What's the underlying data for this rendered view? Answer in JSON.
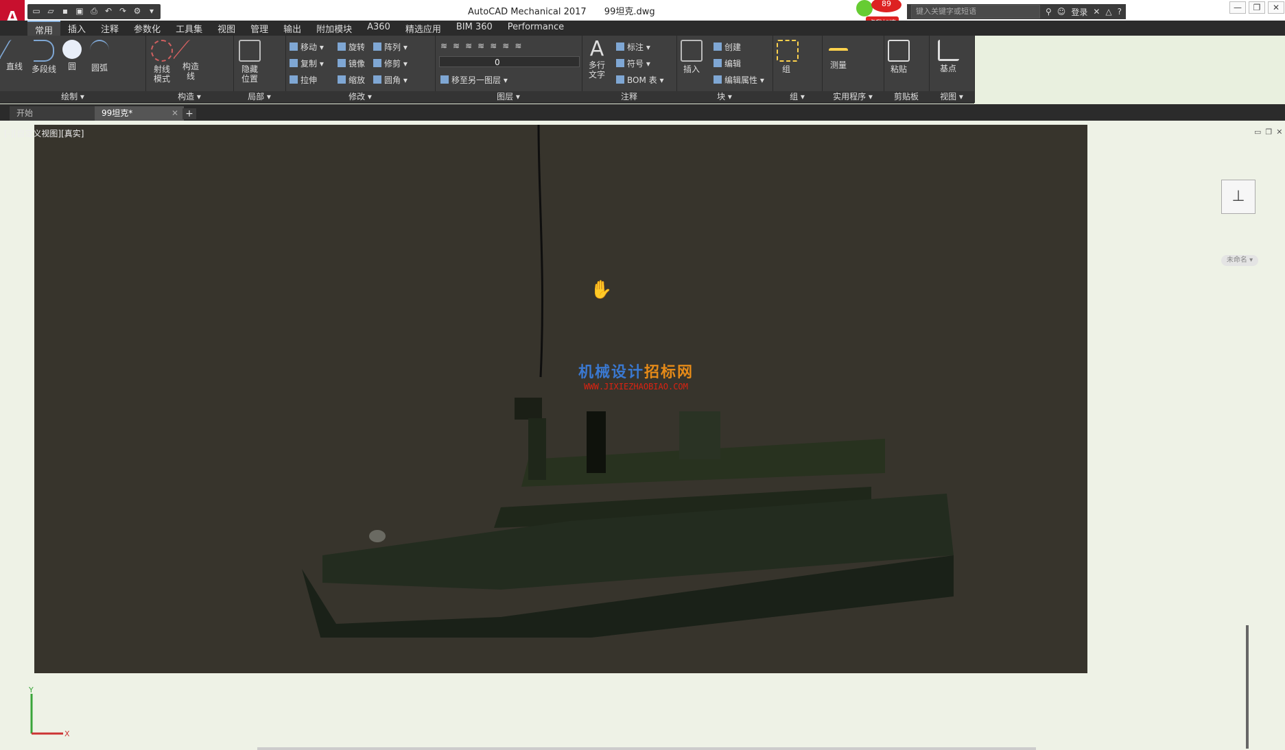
{
  "titlebar": {
    "app_title": "AutoCAD Mechanical 2017",
    "file_name": "99坦克.dwg",
    "logo_text": "A",
    "badge_count": "89",
    "badge_label": "点我加速",
    "search_placeholder": "键入关键字或短语",
    "login_label": "登录"
  },
  "ribbon_tabs": [
    "常用",
    "插入",
    "注释",
    "参数化",
    "工具集",
    "视图",
    "管理",
    "输出",
    "附加模块",
    "A360",
    "精选应用",
    "BIM 360",
    "Performance"
  ],
  "panels": {
    "draw": {
      "title": "绘制",
      "line": "直线",
      "polyline": "多段线",
      "circle": "圆",
      "arc": "圆弧"
    },
    "construct": {
      "title": "构造",
      "ray_mode": "射线\n模式",
      "construct_line": "构造\n线"
    },
    "local": {
      "title": "局部",
      "hide_pos": "隐藏\n位置"
    },
    "modify": {
      "title": "修改",
      "move": "移动",
      "rotate": "旋转",
      "array": "阵列",
      "copy": "复制",
      "mirror": "镜像",
      "trim": "修剪",
      "stretch": "拉伸",
      "scale": "缩放",
      "fillet": "圆角"
    },
    "layer": {
      "title": "图层",
      "current_layer": "0",
      "move_to_layer": "移至另一图层"
    },
    "annotation": {
      "title": "注释",
      "mtext": "多行\n文字",
      "dimension": "标注",
      "symbol": "符号",
      "bom": "BOM 表"
    },
    "block": {
      "title": "块",
      "insert": "插入",
      "create": "创建",
      "edit": "编辑",
      "edit_attr": "编辑属性"
    },
    "group": {
      "title": "组",
      "group": "组"
    },
    "utilities": {
      "title": "实用程序",
      "measure": "测量"
    },
    "clipboard": {
      "title": "剪贴板",
      "paste": "粘贴"
    },
    "view": {
      "title": "视图",
      "base": "基点"
    }
  },
  "doc_tabs": {
    "start": "开始",
    "current": "99坦克*"
  },
  "viewport": {
    "label": "[-][自定义视图][真实]",
    "watermark_line1_blue": "机械设计",
    "watermark_line1_orange": "招标网",
    "watermark_line2": "WWW.JIXIEZHAOBIAO.COM",
    "viewcube_name": "未命名"
  },
  "colors": {
    "viewport_bg": "#37342c",
    "tank_body": "#232c1f",
    "ribbon_bg": "#3f3f3f",
    "accent": "#c8102e"
  }
}
